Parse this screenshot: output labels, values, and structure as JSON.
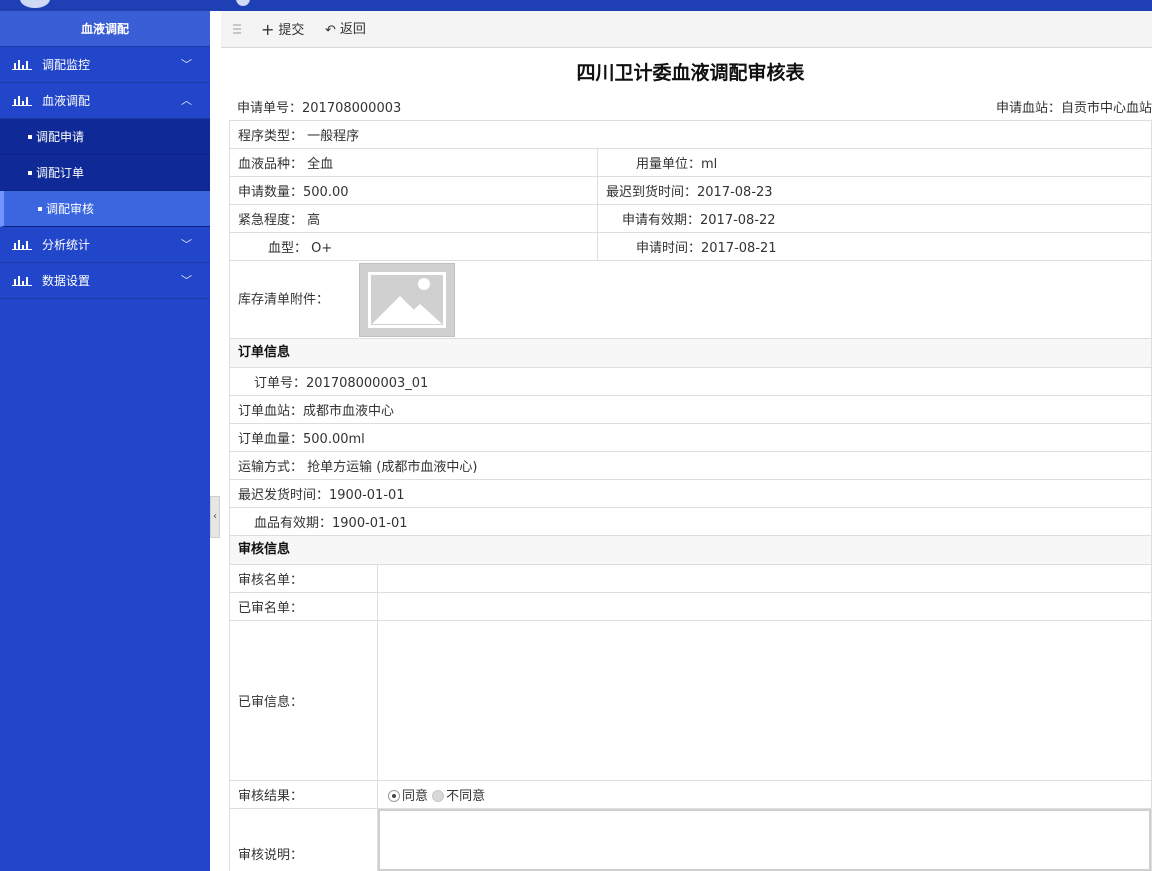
{
  "sidebar": {
    "title": "血液调配",
    "items": [
      {
        "label": "调配监控",
        "chevron": "﹀"
      },
      {
        "label": "血液调配",
        "chevron": "︿"
      },
      {
        "label": "分析统计",
        "chevron": "﹀"
      },
      {
        "label": "数据设置",
        "chevron": "﹀"
      }
    ],
    "sub_items": [
      {
        "label": "调配申请"
      },
      {
        "label": "调配订单"
      },
      {
        "label": "调配审核",
        "active": true
      }
    ]
  },
  "toolbar": {
    "submit_label": "提交",
    "back_label": "返回"
  },
  "form": {
    "title": "四川卫计委血液调配审核表",
    "apply_no_label": "申请单号：",
    "apply_no": "201708000003",
    "apply_station_label": "申请血站：",
    "apply_station": "自贡市中心血站",
    "procedure_type_label": "程序类型：",
    "procedure_type": "一般程序",
    "blood_variety_label": "血液品种：",
    "blood_variety": "全血",
    "unit_label": "用量单位：",
    "unit": "ml",
    "apply_qty_label": "申请数量：",
    "apply_qty": "500.00",
    "latest_arrival_label": "最迟到货时间：",
    "latest_arrival": "2017-08-23",
    "urgency_label": "紧急程度：",
    "urgency": "高",
    "validity_label": "申请有效期：",
    "validity": "2017-08-22",
    "blood_type_label": "血型：",
    "blood_type": "O+",
    "apply_time_label": "申请时间：",
    "apply_time": "2017-08-21",
    "attachment_label": "库存清单附件："
  },
  "order": {
    "section_title": "订单信息",
    "order_no_label": "订单号：",
    "order_no": "201708000003_01",
    "order_station_label": "订单血站：",
    "order_station": "成都市血液中心",
    "order_volume_label": "订单血量：",
    "order_volume": "500.00ml",
    "transport_label": "运输方式：",
    "transport": "抢单方运输 (成都市血液中心)",
    "latest_ship_label": "最迟发货时间：",
    "latest_ship": "1900-01-01",
    "product_validity_label": "血品有效期：",
    "product_validity": "1900-01-01"
  },
  "review": {
    "section_title": "审核信息",
    "reviewer_list_label": "审核名单：",
    "reviewed_list_label": "已审名单：",
    "reviewed_info_label": "已审信息：",
    "result_label": "审核结果：",
    "option_agree": "同意",
    "option_disagree": "不同意",
    "selected": "同意",
    "note_label": "审核说明："
  }
}
